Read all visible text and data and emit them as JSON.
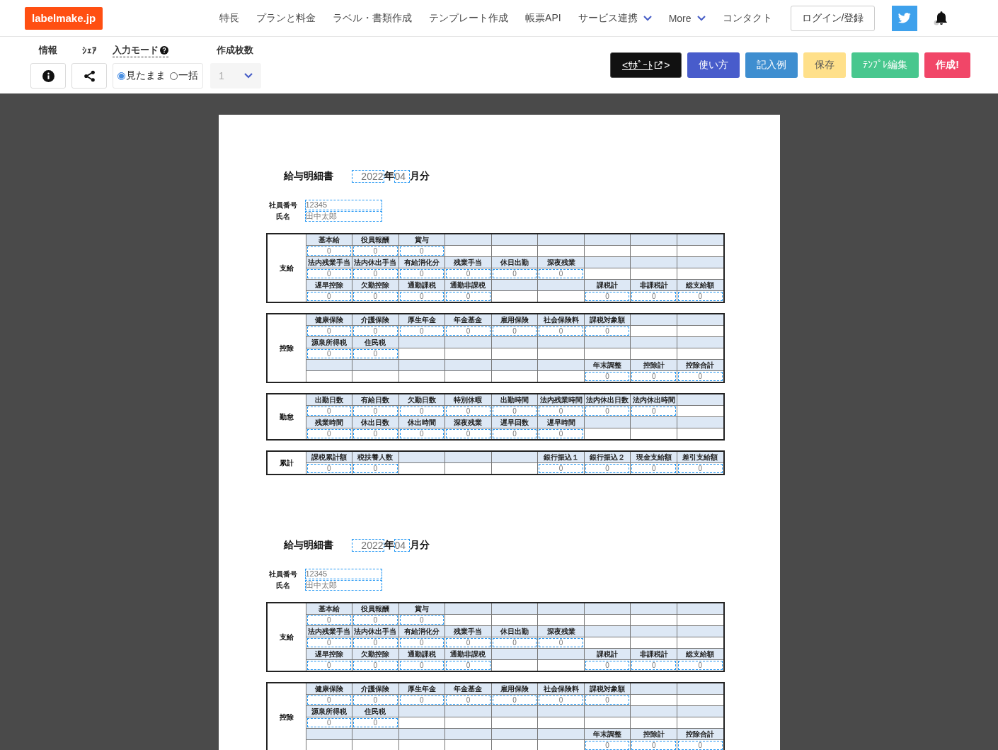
{
  "logo": "labelmake.jp",
  "nav": [
    {
      "label": "特長",
      "dropdown": false
    },
    {
      "label": "プランと料金",
      "dropdown": false
    },
    {
      "label": "ラベル・書類作成",
      "dropdown": false
    },
    {
      "label": "テンプレート作成",
      "dropdown": false
    },
    {
      "label": "帳票API",
      "dropdown": false
    },
    {
      "label": "サービス連携",
      "dropdown": true
    },
    {
      "label": "More",
      "dropdown": true
    },
    {
      "label": "コンタクト",
      "dropdown": false
    }
  ],
  "login": "ログイン/登録",
  "toolbar": {
    "info_label": "情報",
    "share_label": "ｼｪｱ",
    "input_mode": {
      "label": "入力モード",
      "options": [
        {
          "label": "見たまま",
          "selected": true
        },
        {
          "label": "一括",
          "selected": false
        }
      ]
    },
    "copies": {
      "label": "作成枚数",
      "placeholder": "1"
    }
  },
  "actions": [
    {
      "kind": "support",
      "label": "<ｻﾎﾟｰﾄ",
      "closing": ">"
    },
    {
      "kind": "help",
      "label": "使い方"
    },
    {
      "kind": "example",
      "label": "記入例"
    },
    {
      "kind": "save",
      "label": "保存"
    },
    {
      "kind": "edit",
      "label": "ﾃﾝﾌﾟﾚ編集"
    },
    {
      "kind": "create",
      "label": "作成!"
    }
  ],
  "sheets": [
    {
      "title": "給与明細書",
      "year": "2022",
      "year_unit": "年",
      "month": "04",
      "month_unit": "月分",
      "fields": [
        {
          "label": "社員番号",
          "value": "12345"
        },
        {
          "label": "氏名",
          "value": "田中太郎"
        }
      ],
      "sections": [
        {
          "label": "支給",
          "rows": [
            [
              {
                "label": "基本給",
                "value": "0"
              },
              {
                "label": "役員報酬",
                "value": "0"
              },
              {
                "label": "賞与",
                "value": "0"
              },
              null,
              null,
              null,
              null,
              null,
              null
            ],
            [
              {
                "label": "法内残業手当",
                "value": "0"
              },
              {
                "label": "法内休出手当",
                "value": "0"
              },
              {
                "label": "有給消化分",
                "value": "0"
              },
              {
                "label": "残業手当",
                "value": "0"
              },
              {
                "label": "休日出勤",
                "value": "0"
              },
              {
                "label": "深夜残業",
                "value": "0"
              },
              null,
              null,
              null
            ],
            [
              {
                "label": "遅早控除",
                "value": "0"
              },
              {
                "label": "欠勤控除",
                "value": "0"
              },
              {
                "label": "通勤課税",
                "value": "0"
              },
              {
                "label": "通勤非課税",
                "value": "0"
              },
              null,
              null,
              {
                "label": "課税計",
                "value": "0"
              },
              {
                "label": "非課税計",
                "value": "0"
              },
              {
                "label": "総支給額",
                "value": "0"
              }
            ]
          ]
        },
        {
          "label": "控除",
          "rows": [
            [
              {
                "label": "健康保険",
                "value": "0"
              },
              {
                "label": "介護保険",
                "value": "0"
              },
              {
                "label": "厚生年金",
                "value": "0"
              },
              {
                "label": "年金基金",
                "value": "0"
              },
              {
                "label": "雇用保険",
                "value": "0"
              },
              {
                "label": "社会保険料",
                "value": "0"
              },
              {
                "label": "課税対象額",
                "value": "0"
              },
              null,
              null
            ],
            [
              {
                "label": "源泉所得税",
                "value": "0"
              },
              {
                "label": "住民税",
                "value": "0"
              },
              null,
              null,
              null,
              null,
              null,
              null,
              null
            ],
            [
              null,
              null,
              null,
              null,
              null,
              null,
              {
                "label": "年末調整",
                "value": "0"
              },
              {
                "label": "控除計",
                "value": "0"
              },
              {
                "label": "控除合計",
                "value": "0"
              }
            ]
          ]
        },
        {
          "label": "勤怠",
          "rows": [
            [
              {
                "label": "出勤日数",
                "value": "0"
              },
              {
                "label": "有給日数",
                "value": "0"
              },
              {
                "label": "欠勤日数",
                "value": "0"
              },
              {
                "label": "特別休暇",
                "value": "0"
              },
              {
                "label": "出勤時間",
                "value": "0"
              },
              {
                "label": "法内残業時間",
                "value": "0"
              },
              {
                "label": "法内休出日数",
                "value": "0"
              },
              {
                "label": "法内休出時間",
                "value": "0"
              },
              null
            ],
            [
              {
                "label": "残業時間",
                "value": "0"
              },
              {
                "label": "休出日数",
                "value": "0"
              },
              {
                "label": "休出時間",
                "value": "0"
              },
              {
                "label": "深夜残業",
                "value": "0"
              },
              {
                "label": "遅早回数",
                "value": "0"
              },
              {
                "label": "遅早時間",
                "value": "0"
              },
              null,
              null,
              null
            ]
          ]
        },
        {
          "label": "累計",
          "rows": [
            [
              {
                "label": "課税累計額",
                "value": "0"
              },
              {
                "label": "税扶養人数",
                "value": "0"
              },
              null,
              null,
              null,
              {
                "label": "銀行振込１",
                "value": "0"
              },
              {
                "label": "銀行振込２",
                "value": "0"
              },
              {
                "label": "現金支給額",
                "value": "0"
              },
              {
                "label": "差引支給額",
                "value": "0"
              }
            ]
          ]
        }
      ]
    },
    {
      "title": "給与明細書",
      "year": "2022",
      "year_unit": "年",
      "month": "04",
      "month_unit": "月分",
      "fields": [
        {
          "label": "社員番号",
          "value": "12345"
        },
        {
          "label": "氏名",
          "value": "田中太郎"
        }
      ],
      "sections": [
        {
          "label": "支給",
          "rows": [
            [
              {
                "label": "基本給",
                "value": "0"
              },
              {
                "label": "役員報酬",
                "value": "0"
              },
              {
                "label": "賞与",
                "value": "0"
              },
              null,
              null,
              null,
              null,
              null,
              null
            ],
            [
              {
                "label": "法内残業手当",
                "value": "0"
              },
              {
                "label": "法内休出手当",
                "value": "0"
              },
              {
                "label": "有給消化分",
                "value": "0"
              },
              {
                "label": "残業手当",
                "value": "0"
              },
              {
                "label": "休日出勤",
                "value": "0"
              },
              {
                "label": "深夜残業",
                "value": "0"
              },
              null,
              null,
              null
            ],
            [
              {
                "label": "遅早控除",
                "value": "0"
              },
              {
                "label": "欠勤控除",
                "value": "0"
              },
              {
                "label": "通勤課税",
                "value": "0"
              },
              {
                "label": "通勤非課税",
                "value": "0"
              },
              null,
              null,
              {
                "label": "課税計",
                "value": "0"
              },
              {
                "label": "非課税計",
                "value": "0"
              },
              {
                "label": "総支給額",
                "value": "0"
              }
            ]
          ]
        },
        {
          "label": "控除",
          "rows": [
            [
              {
                "label": "健康保険",
                "value": "0"
              },
              {
                "label": "介護保険",
                "value": "0"
              },
              {
                "label": "厚生年金",
                "value": "0"
              },
              {
                "label": "年金基金",
                "value": "0"
              },
              {
                "label": "雇用保険",
                "value": "0"
              },
              {
                "label": "社会保険料",
                "value": "0"
              },
              {
                "label": "課税対象額",
                "value": "0"
              },
              null,
              null
            ],
            [
              {
                "label": "源泉所得税",
                "value": "0"
              },
              {
                "label": "住民税",
                "value": "0"
              },
              null,
              null,
              null,
              null,
              null,
              null,
              null
            ],
            [
              null,
              null,
              null,
              null,
              null,
              null,
              {
                "label": "年末調整",
                "value": "0"
              },
              {
                "label": "控除計",
                "value": "0"
              },
              {
                "label": "控除合計",
                "value": "0"
              }
            ]
          ]
        }
      ]
    }
  ]
}
